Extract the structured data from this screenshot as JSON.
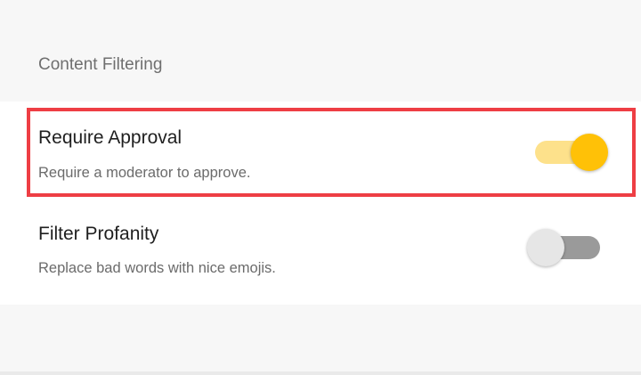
{
  "section": {
    "title": "Content Filtering"
  },
  "settings": [
    {
      "title": "Require Approval",
      "description": "Require a moderator to approve.",
      "enabled": true
    },
    {
      "title": "Filter Profanity",
      "description": "Replace bad words with nice emojis.",
      "enabled": false
    }
  ],
  "colors": {
    "toggle_on_thumb": "#ffc107",
    "toggle_on_track": "#fde18b",
    "toggle_off_thumb": "#e6e6e6",
    "toggle_off_track": "#9a9a9a",
    "highlight": "#ee3e44"
  }
}
